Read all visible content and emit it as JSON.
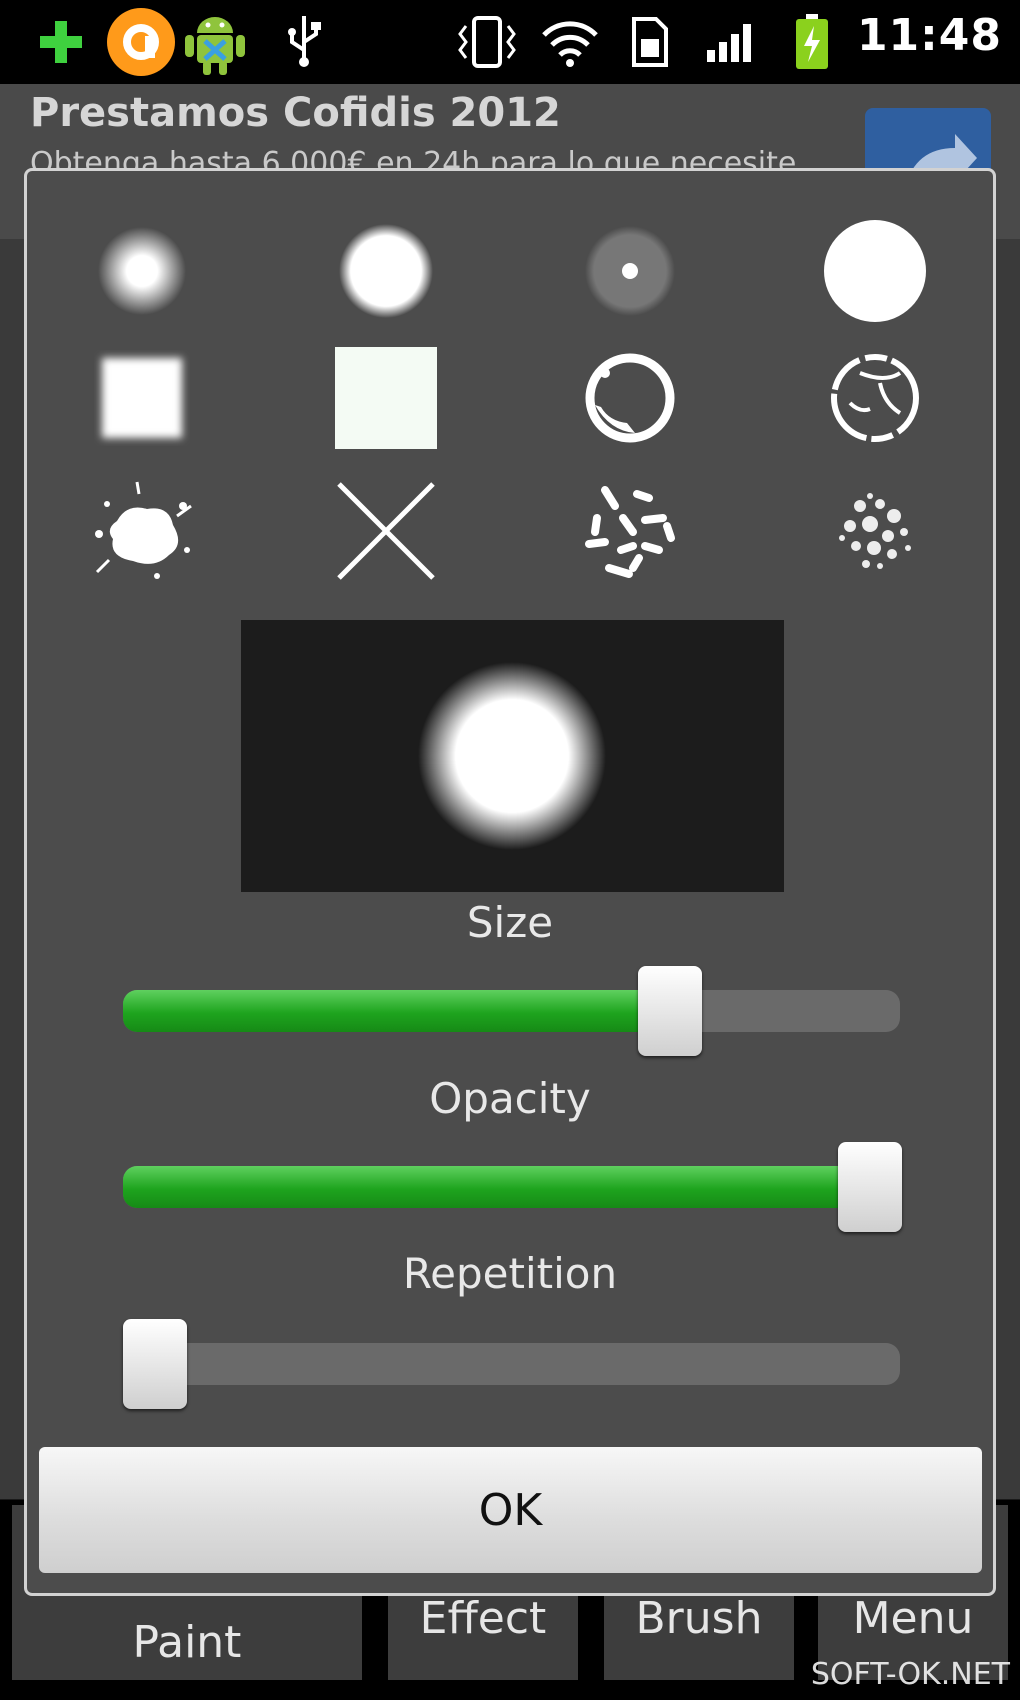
{
  "status_bar": {
    "time": "11:48",
    "icons": [
      "add-icon",
      "app-circle-icon",
      "android-icon",
      "usb-icon",
      "vibrate-icon",
      "wifi-icon",
      "sim-icon",
      "signal-icon",
      "battery-charging-icon"
    ]
  },
  "ad": {
    "title": "Prestamos Cofidis 2012",
    "subtitle": "Obtenga hasta 6.000€ en 24h para lo que necesite"
  },
  "background_buttons": {
    "paint": "Paint",
    "effect": "Effect",
    "brush": "Brush",
    "menu": "Menu"
  },
  "dialog": {
    "brushes": [
      "soft-small",
      "round",
      "ring-dot",
      "hard-circle",
      "soft-square",
      "square",
      "rough-ring",
      "cracked-ring",
      "splatter",
      "cross",
      "dashes",
      "speckle"
    ],
    "sliders": {
      "size": {
        "label": "Size",
        "value_fraction": 0.72
      },
      "opacity": {
        "label": "Opacity",
        "value_fraction": 1.0
      },
      "repetition": {
        "label": "Repetition",
        "value_fraction": 0.0
      }
    },
    "ok_label": "OK",
    "accent_color": "#22aa22"
  },
  "watermark": "SOFT-OK.NET"
}
